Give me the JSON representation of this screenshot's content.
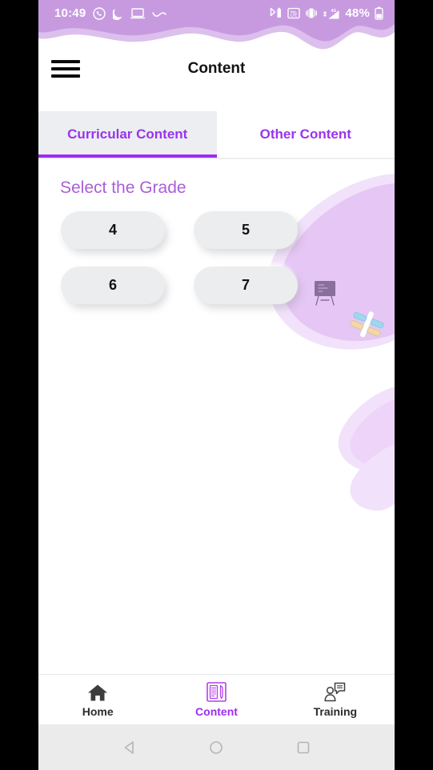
{
  "status_bar": {
    "time": "10:49",
    "battery_percent": "48%",
    "left_icons": [
      "whatsapp-icon",
      "dnd-moon-icon",
      "screencast-icon",
      "tilde-icon"
    ],
    "right_icons": [
      "bluetooth-battery-icon",
      "volte-icon",
      "vibrate-icon",
      "signal-4g-icon",
      "battery-icon"
    ]
  },
  "app_bar": {
    "menu_icon": "hamburger-menu-icon",
    "title": "Content"
  },
  "tabs": [
    {
      "label": "Curricular Content",
      "active": true
    },
    {
      "label": "Other Content",
      "active": false
    }
  ],
  "main": {
    "section_title": "Select the Grade",
    "grades": [
      "4",
      "5",
      "6",
      "7"
    ]
  },
  "bottom_nav": [
    {
      "label": "Home",
      "icon": "home-icon",
      "active": false
    },
    {
      "label": "Content",
      "icon": "content-book-icon",
      "active": true
    },
    {
      "label": "Training",
      "icon": "training-person-icon",
      "active": false
    }
  ],
  "system_nav": {
    "back": "back-triangle-icon",
    "home": "home-circle-icon",
    "recents": "recents-square-icon"
  },
  "colors": {
    "accent_purple": "#9b2df5",
    "tab_text_purple": "#9933ee",
    "heading_purple": "#a95fd8",
    "wave_purple": "#c79ae0",
    "wave_purple_light": "#dcbfec",
    "blob_purple": "#e6c6f5",
    "blob_purple_light": "#f0ddf8",
    "button_gray": "#ebedef",
    "tab_active_bg": "#eceef1",
    "sysnav_bg": "#ebebeb"
  }
}
